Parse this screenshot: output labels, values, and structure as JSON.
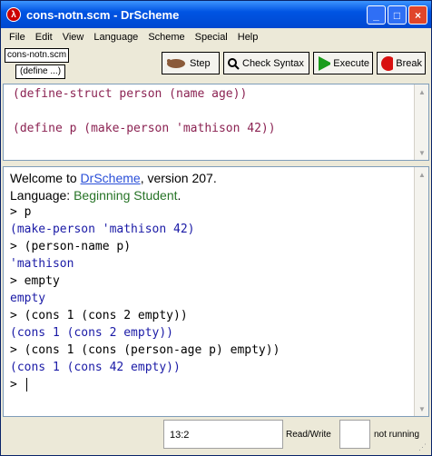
{
  "window": {
    "title": "cons-notn.scm - DrScheme",
    "minimize": "_",
    "maximize": "□",
    "close": "×",
    "app_icon": "λ"
  },
  "menu": [
    "File",
    "Edit",
    "View",
    "Language",
    "Scheme",
    "Special",
    "Help"
  ],
  "toolbar": {
    "file_name": "cons-notn.scm",
    "define_menu": "(define ...)",
    "step_label": "Step",
    "check_syntax_label": "Check Syntax",
    "execute_label": "Execute",
    "break_label": "Break"
  },
  "editor": {
    "lines": [
      "(define-struct person (name age))",
      "(define p (make-person 'mathison 42))"
    ]
  },
  "repl": {
    "welcome_prefix": "Welcome to ",
    "welcome_link": "DrScheme",
    "welcome_suffix": ", version 207.",
    "language_prefix": "Language: ",
    "language_name": "Beginning Student",
    "language_suffix": ".",
    "lines": [
      "> p",
      "(make-person 'mathison 42)",
      "> (person-name p)",
      "'mathison",
      "> empty",
      "empty",
      "> (cons 1 (cons 2 empty))",
      "(cons 1 (cons 2 empty))",
      "> (cons 1 (cons (person-age p) empty))",
      "(cons 1 (cons 42 empty))",
      "> "
    ]
  },
  "status": {
    "position": "13:2",
    "mode": "Read/Write",
    "running": "not running"
  },
  "colors": {
    "keyword": "#8b2252",
    "output": "#1a1aa6",
    "language": "#267326",
    "title_bar": "#0054e3"
  }
}
